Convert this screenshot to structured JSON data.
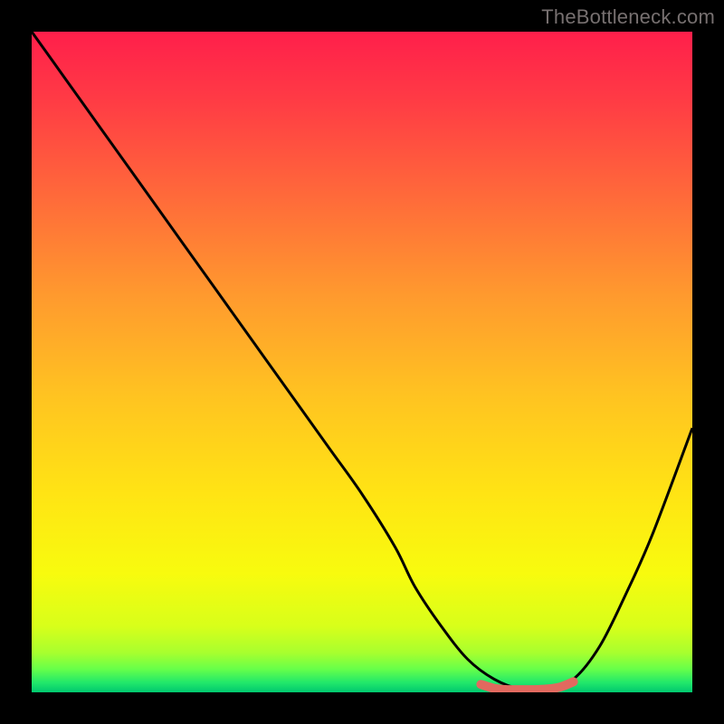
{
  "watermark": "TheBottleneck.com",
  "chart_data": {
    "type": "line",
    "title": "",
    "xlabel": "",
    "ylabel": "",
    "xlim": [
      0,
      100
    ],
    "ylim": [
      0,
      100
    ],
    "grid": false,
    "legend": false,
    "series": [
      {
        "name": "bottleneck-curve",
        "x": [
          0,
          5,
          10,
          15,
          20,
          25,
          30,
          35,
          40,
          45,
          50,
          55,
          58,
          62,
          66,
          70,
          74,
          78,
          82,
          86,
          90,
          94,
          100
        ],
        "values": [
          100,
          93,
          86,
          79,
          72,
          65,
          58,
          51,
          44,
          37,
          30,
          22,
          16,
          10,
          5,
          2,
          0.5,
          0.5,
          2,
          7,
          15,
          24,
          40
        ]
      },
      {
        "name": "optimal-range-marker",
        "x": [
          68,
          70,
          72,
          74,
          76,
          78,
          80,
          82
        ],
        "values": [
          1.2,
          0.6,
          0.4,
          0.4,
          0.4,
          0.5,
          0.8,
          1.6
        ]
      }
    ],
    "gradient_stops": [
      {
        "offset": 0.0,
        "color": "#ff1f4b"
      },
      {
        "offset": 0.1,
        "color": "#ff3a45"
      },
      {
        "offset": 0.25,
        "color": "#ff6a3a"
      },
      {
        "offset": 0.4,
        "color": "#ff9a2e"
      },
      {
        "offset": 0.55,
        "color": "#ffc321"
      },
      {
        "offset": 0.7,
        "color": "#ffe414"
      },
      {
        "offset": 0.82,
        "color": "#f8fb0e"
      },
      {
        "offset": 0.9,
        "color": "#d8ff1a"
      },
      {
        "offset": 0.94,
        "color": "#a8ff2e"
      },
      {
        "offset": 0.965,
        "color": "#66ff4a"
      },
      {
        "offset": 0.985,
        "color": "#22e86a"
      },
      {
        "offset": 1.0,
        "color": "#00c86f"
      }
    ],
    "marker_color": "#e2695f",
    "curve_color": "#000000"
  }
}
